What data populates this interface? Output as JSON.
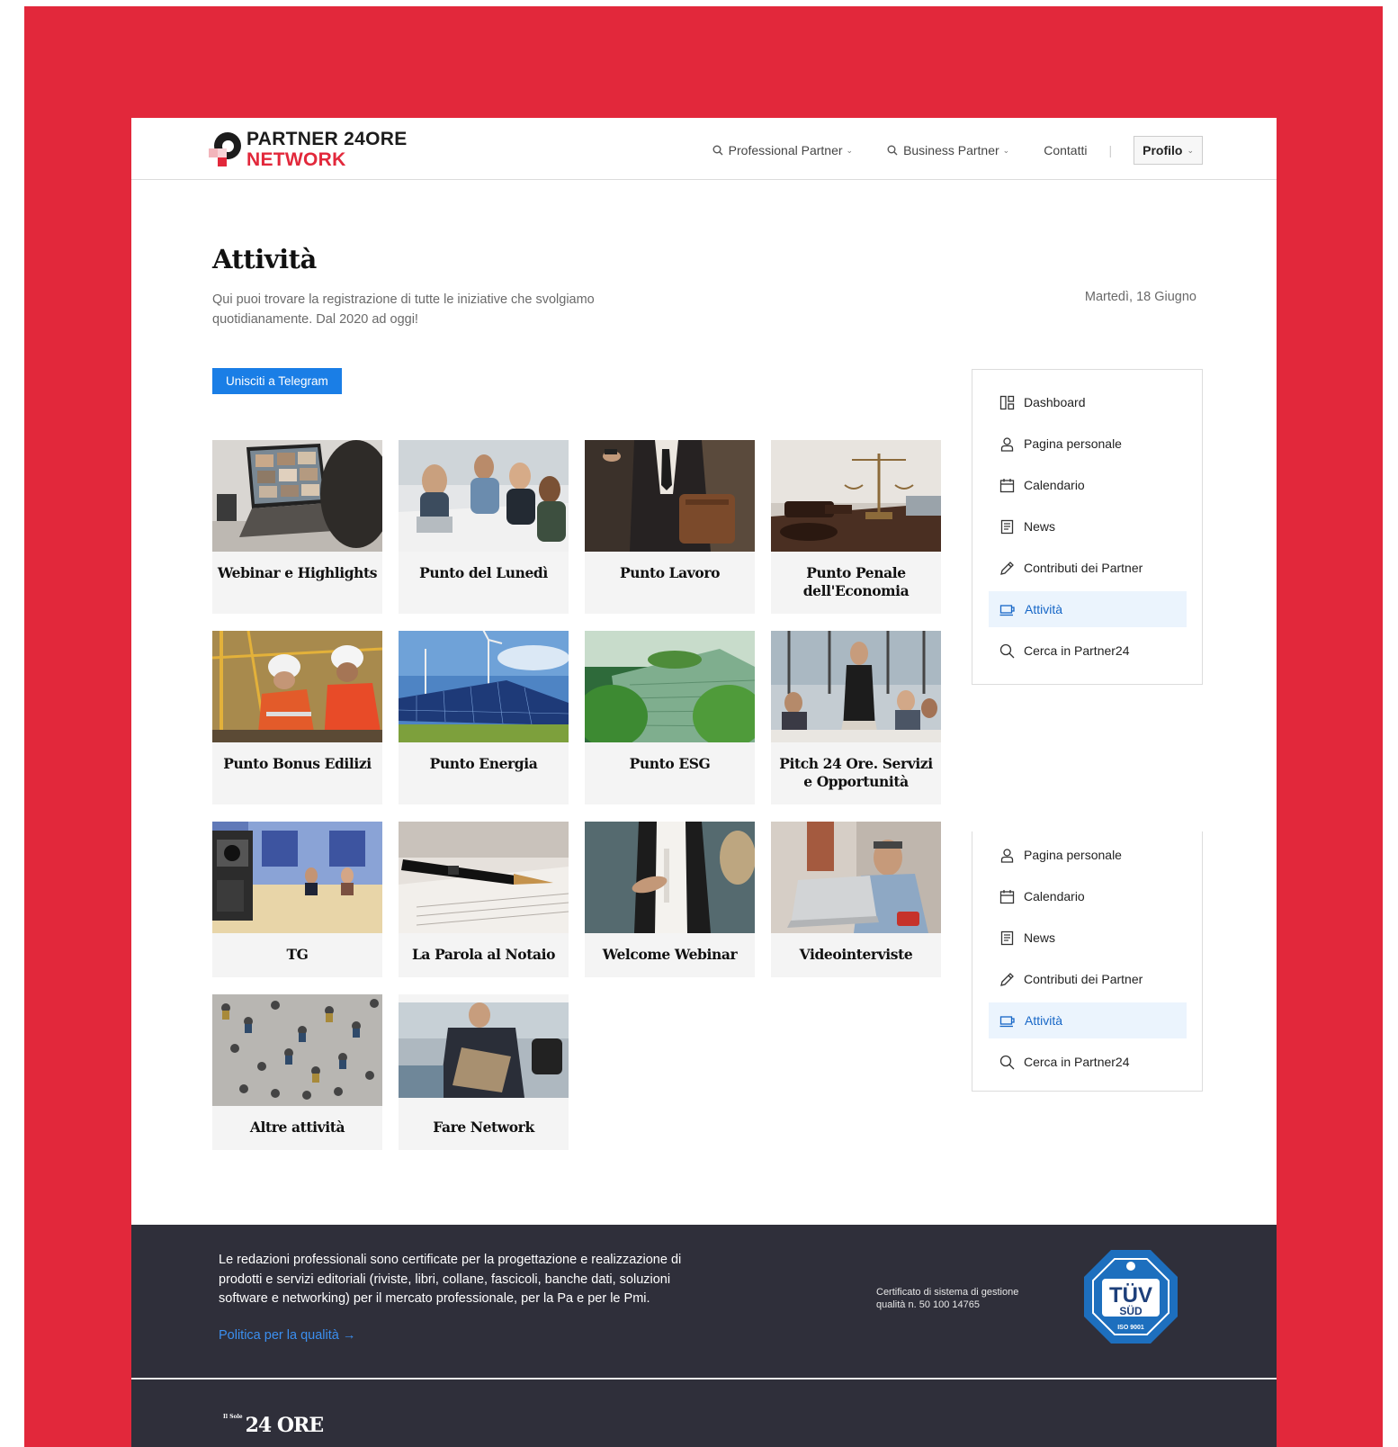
{
  "brand": {
    "line1": "PARTNER 24ORE",
    "line2": "NETWORK"
  },
  "nav": {
    "items": [
      {
        "label": "Professional Partner",
        "icon": "search-icon",
        "dropdown": true
      },
      {
        "label": "Business Partner",
        "icon": "search-icon",
        "dropdown": true
      },
      {
        "label": "Contatti",
        "dropdown": false
      }
    ],
    "separator": "|",
    "profile": "Profilo"
  },
  "page": {
    "title": "Attività",
    "subtitle": "Qui puoi trovare la registrazione di tutte le iniziative che svolgiamo quotidianamente. Dal 2020 ad oggi!",
    "date": "Martedì, 18 Giugno",
    "telegram_button": "Unisciti a Telegram"
  },
  "cards": [
    {
      "label": "Webinar e Highlights"
    },
    {
      "label": "Punto del Lunedì"
    },
    {
      "label": "Punto Lavoro"
    },
    {
      "label": "Punto Penale dell'Economia"
    },
    {
      "label": "Punto Bonus Edilizi"
    },
    {
      "label": "Punto Energia"
    },
    {
      "label": "Punto ESG"
    },
    {
      "label": "Pitch 24 Ore. Servizi e Opportunità"
    },
    {
      "label": "TG"
    },
    {
      "label": "La Parola al Notaio"
    },
    {
      "label": "Welcome Webinar"
    },
    {
      "label": "Videointerviste"
    },
    {
      "label": "Altre attività"
    },
    {
      "label": "Fare Network"
    }
  ],
  "sidebar": {
    "items": [
      {
        "label": "Dashboard",
        "icon": "dashboard-icon"
      },
      {
        "label": "Pagina personale",
        "icon": "user-icon"
      },
      {
        "label": "Calendario",
        "icon": "calendar-icon"
      },
      {
        "label": "News",
        "icon": "document-icon"
      },
      {
        "label": "Contributi dei Partner",
        "icon": "pencil-icon"
      },
      {
        "label": "Attività",
        "icon": "cup-icon",
        "active": true
      },
      {
        "label": "Cerca in Partner24",
        "icon": "search-icon"
      }
    ],
    "sticky_items": [
      {
        "label": "Pagina personale",
        "icon": "user-icon"
      },
      {
        "label": "Calendario",
        "icon": "calendar-icon"
      },
      {
        "label": "News",
        "icon": "document-icon"
      },
      {
        "label": "Contributi dei Partner",
        "icon": "pencil-icon"
      },
      {
        "label": "Attività",
        "icon": "cup-icon",
        "active": true
      },
      {
        "label": "Cerca in Partner24",
        "icon": "search-icon"
      }
    ]
  },
  "footer": {
    "text": "Le redazioni professionali sono certificate per la progettazione e realizzazione di prodotti e servizi editoriali (riviste, libri, collane, fascicoli, banche dati, soluzioni software e networking) per il mercato professionale, per la Pa e per le Pmi.",
    "link": "Politica per la qualità →",
    "cert": "Certificato di sistema di gestione qualità n. 50 100 14765",
    "badge": {
      "top": "TÜV",
      "mid": "SÜD",
      "bottom": "ISO 9001"
    },
    "logo_small": "Il Sole",
    "logo_main": "24 ORE"
  },
  "colors": {
    "accent_red": "#e2283b",
    "link_blue": "#1a7ee6",
    "active_blue": "#1767c7",
    "footer_bg": "#2f2f3a"
  }
}
